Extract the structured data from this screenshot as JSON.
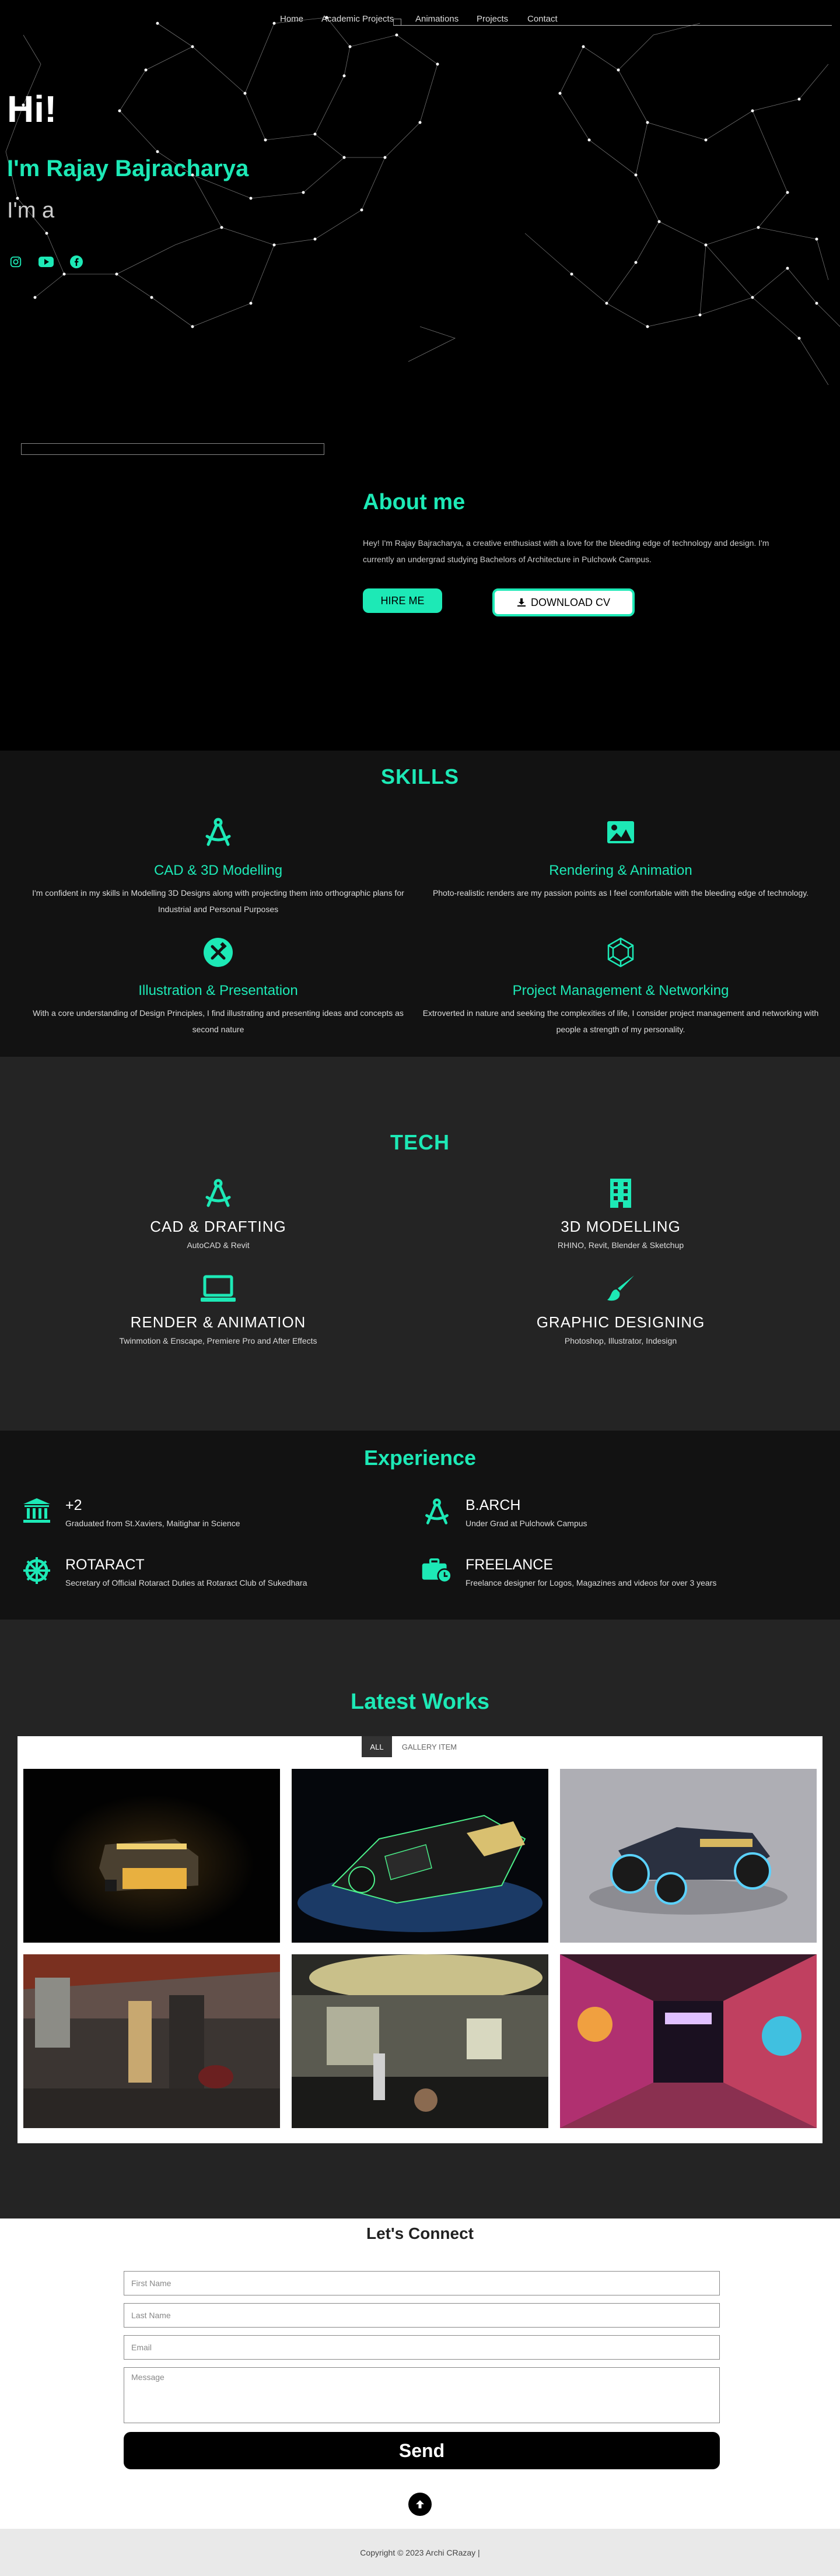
{
  "nav": {
    "items": [
      "Home",
      "Academic Projects",
      "Animations",
      "Projects",
      "Contact"
    ]
  },
  "hero": {
    "greeting": "Hi!",
    "name": "I'm Rajay Bajracharya",
    "role_prefix": "I'm a",
    "social": [
      "instagram-icon",
      "youtube-icon",
      "facebook-icon"
    ]
  },
  "about": {
    "title": "About me",
    "body": "Hey! I'm Rajay Bajracharya, a creative enthusiast with a love for the bleeding edge of technology and design. I'm currently an undergrad studying Bachelors of Architecture in Pulchowk Campus.",
    "hire_label": "HIRE ME",
    "cv_label": "DOWNLOAD CV"
  },
  "skills": {
    "title": "SKILLS",
    "items": [
      {
        "title": "CAD & 3D Modelling",
        "desc": "I'm confident in my skills in Modelling 3D Designs along with projecting them into orthographic plans for Industrial and Personal Purposes",
        "icon": "drafting-compass-icon"
      },
      {
        "title": "Rendering & Animation",
        "desc": "Photo-realistic renders are my passion points as I feel comfortable with the bleeding edge of technology.",
        "icon": "image-icon"
      },
      {
        "title": "Illustration & Presentation",
        "desc": "With a core understanding of Design Principles, I find illustrating and presenting ideas and concepts as second nature",
        "icon": "hammer-wrench-icon"
      },
      {
        "title": "Project Management & Networking",
        "desc": "Extroverted in nature and seeking the complexities of life, I consider project management and networking with people a strength of my personality.",
        "icon": "network-icon"
      }
    ]
  },
  "tech": {
    "title": "TECH",
    "items": [
      {
        "title": "CAD & DRAFTING",
        "desc": "AutoCAD & Revit",
        "icon": "drafting-compass-icon"
      },
      {
        "title": "3D MODELLING",
        "desc": "RHINO, Revit, Blender & Sketchup",
        "icon": "building-icon"
      },
      {
        "title": "RENDER & ANIMATION",
        "desc": "Twinmotion & Enscape, Premiere Pro and After Effects",
        "icon": "laptop-icon"
      },
      {
        "title": "GRAPHIC DESIGNING",
        "desc": "Photoshop, Illustrator, Indesign",
        "icon": "paint-brush-icon"
      }
    ]
  },
  "experience": {
    "title": "Experience",
    "items": [
      {
        "title": "+2",
        "desc": "Graduated from St.Xaviers, Maitighar in Science",
        "icon": "institution-icon"
      },
      {
        "title": "B.ARCH",
        "desc": "Under Grad at Pulchowk Campus",
        "icon": "drafting-compass-icon"
      },
      {
        "title": "ROTARACT",
        "desc": "Secretary of Official Rotaract Duties at Rotaract Club of Sukedhara",
        "icon": "dharma-wheel-icon"
      },
      {
        "title": "FREELANCE",
        "desc": "Freelance designer for Logos, Magazines and videos for over 3 years",
        "icon": "briefcase-clock-icon"
      }
    ]
  },
  "works": {
    "title": "Latest Works",
    "filters": [
      "ALL",
      "GALLERY ITEM"
    ]
  },
  "connect": {
    "title": "Let's Connect",
    "first_name_ph": "First Name",
    "last_name_ph": "Last Name",
    "email_ph": "Email",
    "message_ph": "Message",
    "send_label": "Send"
  },
  "footer": {
    "copyright": "Copyright © 2023 Archi CRazay |"
  },
  "colors": {
    "accent": "#1de9b6",
    "bg_dark": "#000000",
    "bg_section": "#121212",
    "bg_section_alt": "#242424"
  }
}
